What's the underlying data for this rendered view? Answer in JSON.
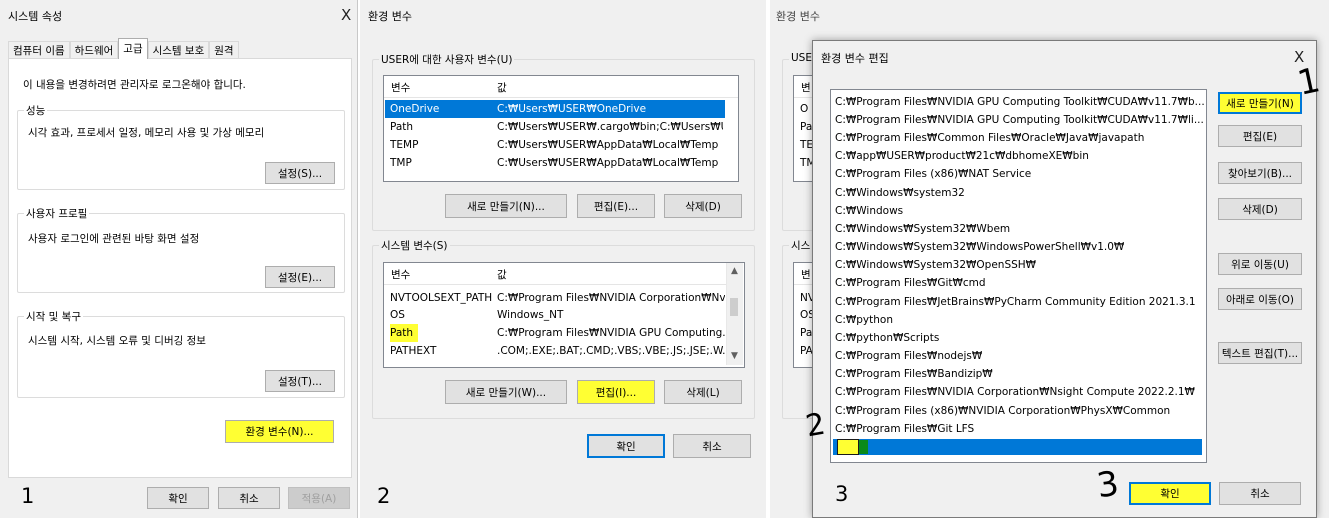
{
  "panel1": {
    "title": "시스템 속성",
    "close_glyph": "X",
    "tabs": [
      "컴퓨터 이름",
      "하드웨어",
      "고급",
      "시스템 보호",
      "원격"
    ],
    "admin_note": "이 내용을 변경하려면 관리자로 로그온해야 합니다.",
    "performance": {
      "label": "성능",
      "desc": "시각 효과, 프로세서 일정, 메모리 사용 및 가상 메모리",
      "button": "설정(S)..."
    },
    "profile": {
      "label": "사용자 프로필",
      "desc": "사용자 로그인에 관련된 바탕 화면 설정",
      "button": "설정(E)..."
    },
    "startup": {
      "label": "시작 및 복구",
      "desc": "시스템 시작, 시스템 오류 및 디버깅 정보",
      "button": "설정(T)..."
    },
    "env_button": "환경 변수(N)...",
    "ok": "확인",
    "cancel": "취소",
    "apply": "적용(A)",
    "number": "1"
  },
  "panel2": {
    "title": "환경 변수",
    "user_group": "USER에 대한 사용자 변수(U)",
    "col_var": "변수",
    "col_val": "값",
    "user_vars": [
      {
        "name": "OneDrive",
        "value": "C:₩Users₩USER₩OneDrive"
      },
      {
        "name": "Path",
        "value": "C:₩Users₩USER₩.cargo₩bin;C:₩Users₩USE..."
      },
      {
        "name": "TEMP",
        "value": "C:₩Users₩USER₩AppData₩Local₩Temp"
      },
      {
        "name": "TMP",
        "value": "C:₩Users₩USER₩AppData₩Local₩Temp"
      }
    ],
    "user_buttons": {
      "new": "새로 만들기(N)...",
      "edit": "편집(E)...",
      "delete": "삭제(D)"
    },
    "sys_group": "시스템 변수(S)",
    "sys_vars": [
      {
        "name": "NVTOOLSEXT_PATH",
        "value": "C:₩Program Files₩NVIDIA Corporation₩Nv..."
      },
      {
        "name": "OS",
        "value": "Windows_NT"
      },
      {
        "name": "Path",
        "value": "C:₩Program Files₩NVIDIA GPU Computing..."
      },
      {
        "name": "PATHEXT",
        "value": ".COM;.EXE;.BAT;.CMD;.VBS;.VBE;.JS;.JSE;.W..."
      }
    ],
    "sys_buttons": {
      "new": "새로 만들기(W)...",
      "edit": "편집(I)...",
      "delete": "삭제(L)"
    },
    "ok": "확인",
    "cancel": "취소",
    "number": "2"
  },
  "panel3": {
    "back_title": "환경 변수",
    "back_group": "USER",
    "back_col": "변",
    "back_rows": [
      "O",
      "Pa",
      "TE",
      "TM"
    ],
    "back_sys_group": "시스",
    "back_sys_col": "변",
    "back_sys_rows": [
      "NV",
      "OS",
      "Pa",
      "PA"
    ],
    "title": "환경 변수 편집",
    "close_glyph": "X",
    "entries": [
      "C:₩Program Files₩NVIDIA GPU Computing Toolkit₩CUDA₩v11.7₩b...",
      "C:₩Program Files₩NVIDIA GPU Computing Toolkit₩CUDA₩v11.7₩li...",
      "C:₩Program Files₩Common Files₩Oracle₩Java₩javapath",
      "C:₩app₩USER₩product₩21c₩dbhomeXE₩bin",
      "C:₩Program Files (x86)₩NAT Service",
      "C:₩Windows₩system32",
      "C:₩Windows",
      "C:₩Windows₩System32₩Wbem",
      "C:₩Windows₩System32₩WindowsPowerShell₩v1.0₩",
      "C:₩Windows₩System32₩OpenSSH₩",
      "C:₩Program Files₩Git₩cmd",
      "C:₩Program Files₩JetBrains₩PyCharm Community Edition 2021.3.1",
      "C:₩python",
      "C:₩python₩Scripts",
      "C:₩Program Files₩nodejs₩",
      "C:₩Program Files₩Bandizip₩",
      "C:₩Program Files₩NVIDIA Corporation₩Nsight Compute 2022.2.1₩",
      "C:₩Program Files (x86)₩NVIDIA Corporation₩PhysX₩Common",
      "C:₩Program Files₩Git LFS"
    ],
    "buttons": {
      "new": "새로 만들기(N)",
      "edit": "편집(E)",
      "browse": "찾아보기(B)...",
      "delete": "삭제(D)",
      "up": "위로 이동(U)",
      "down": "아래로 이동(O)",
      "text_edit": "텍스트 편집(T)..."
    },
    "ok": "확인",
    "cancel": "취소",
    "number": "3"
  },
  "annotations": {
    "step1": "1",
    "step2": "2",
    "step3": "3"
  },
  "colors": {
    "selection": "#0078d7",
    "highlight": "#ffff33",
    "editing_cursor": "#0a8a1a"
  }
}
